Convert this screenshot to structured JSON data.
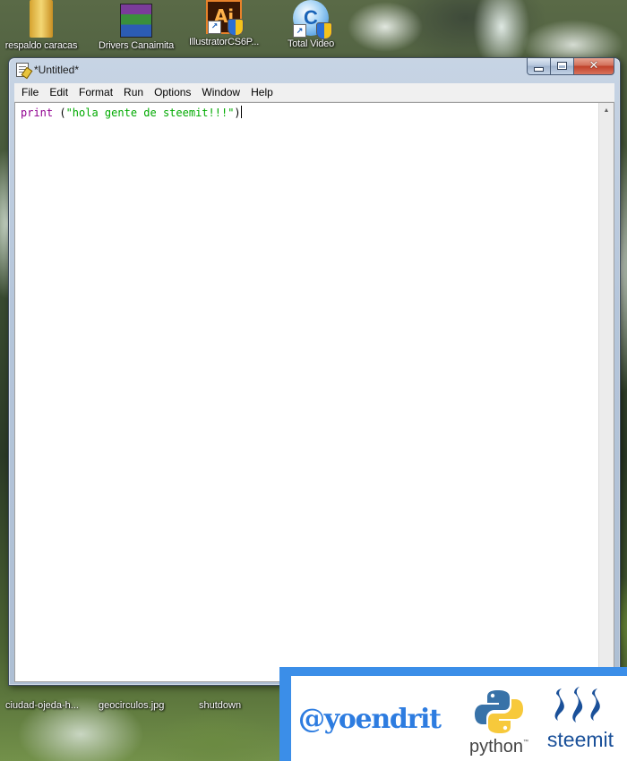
{
  "desktop": {
    "top_icons": [
      {
        "label": "respaldo caracas",
        "icon": "folder-icon"
      },
      {
        "label": "Drivers Canaimita",
        "icon": "winrar-archive-icon"
      },
      {
        "label": "IllustratorCS6P...",
        "icon": "illustrator-icon"
      },
      {
        "label": "Total Video",
        "icon": "total-video-converter-icon"
      }
    ],
    "bottom_icons": [
      {
        "label": "ciudad-ojeda-h..."
      },
      {
        "label": "geocirculos.jpg"
      },
      {
        "label": "shutdown"
      }
    ]
  },
  "window": {
    "title": "*Untitled*",
    "menu": [
      "File",
      "Edit",
      "Format",
      "Run",
      "Options",
      "Window",
      "Help"
    ],
    "editor": {
      "builtin": "print",
      "open_paren": " (",
      "string_literal": "\"hola gente de steemit!!!\"",
      "close_paren": ")"
    },
    "caption_buttons": [
      "minimize",
      "maximize",
      "close"
    ]
  },
  "banner": {
    "handle": "@yoendrit",
    "python_word": "python",
    "python_tm": "™",
    "steemit_word": "steemit",
    "colors": {
      "border": "#3b8ee8",
      "handle": "#2d7ce0",
      "python_blue": "#3872a8",
      "python_yellow": "#f7c93b",
      "steemit_blue": "#1a5099"
    }
  },
  "colors": {
    "builtin": "#900090",
    "string": "#00aa00"
  }
}
